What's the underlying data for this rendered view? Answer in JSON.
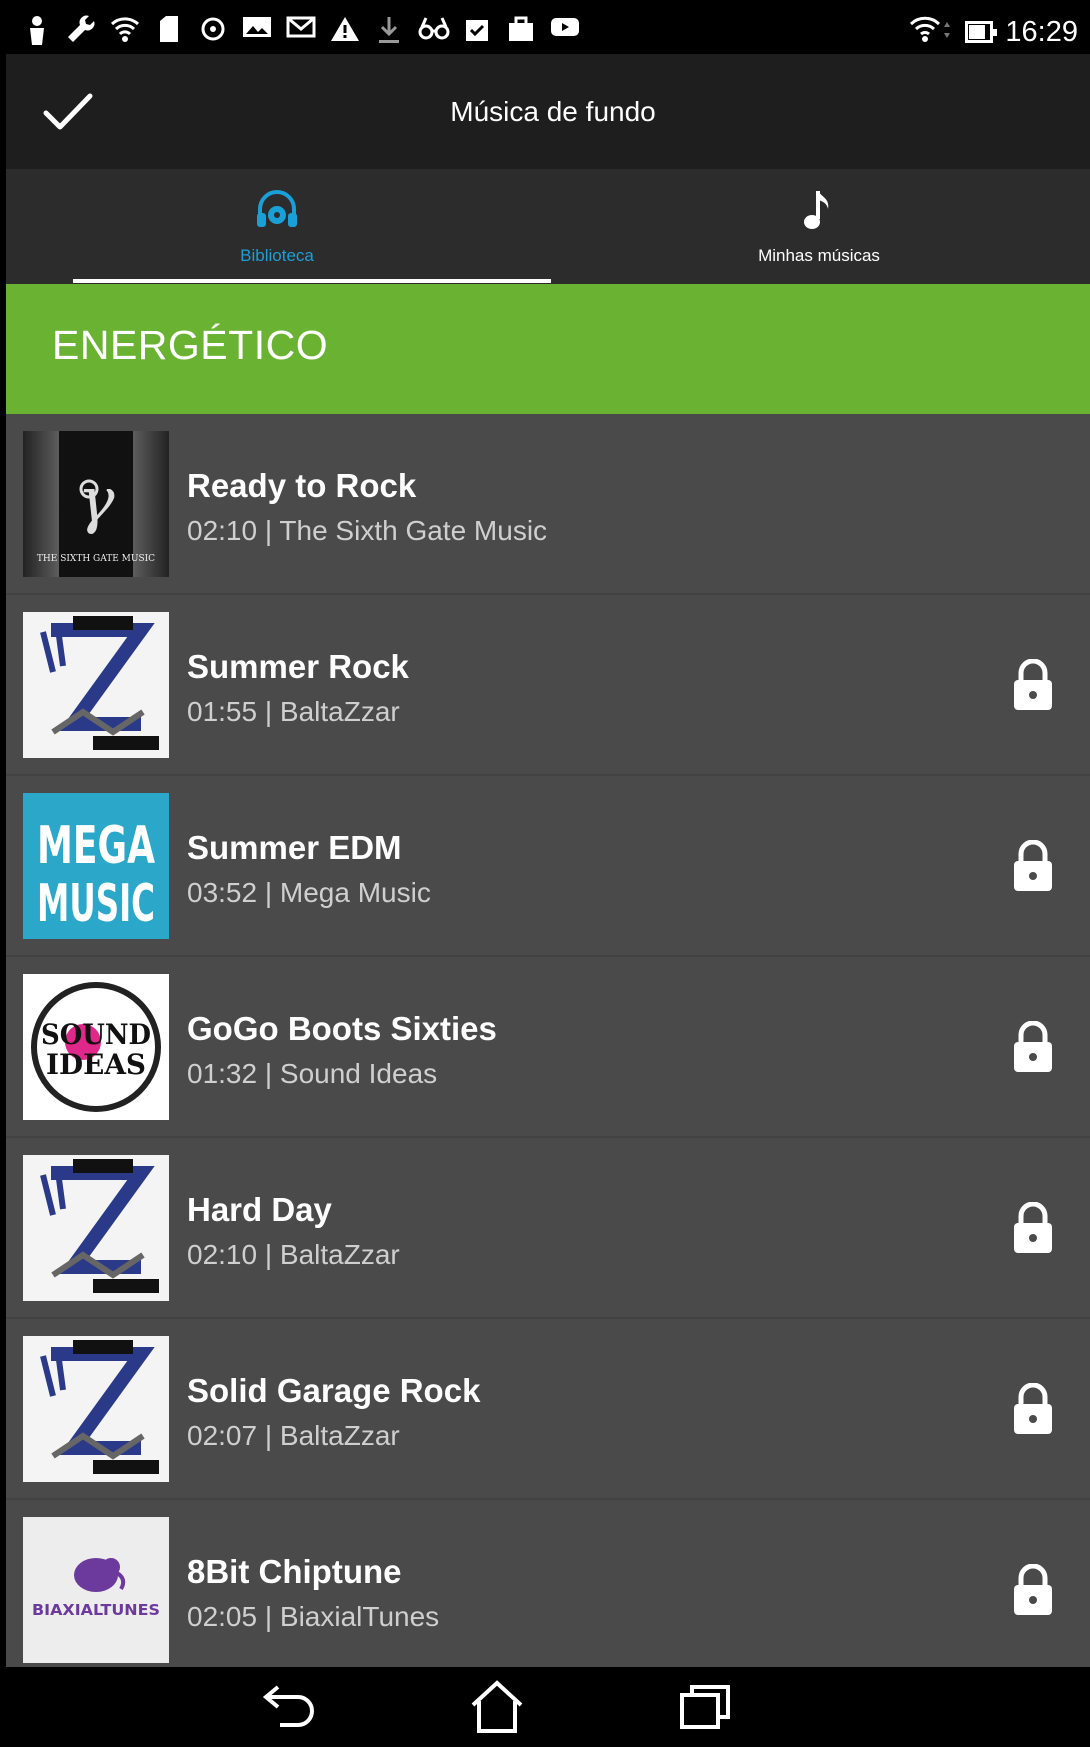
{
  "status_bar": {
    "time": "16:29",
    "left_icons": [
      "person-icon",
      "wrench-icon",
      "wifi-icon",
      "sd-card-icon",
      "sync-icon",
      "image-icon",
      "mail-icon",
      "warning-icon",
      "download-icon",
      "glasses-icon",
      "clipboard-check-icon",
      "bag-icon",
      "youtube-icon"
    ],
    "right_icons": [
      "wifi-icon",
      "battery-icon"
    ]
  },
  "app_bar": {
    "title": "Música de fundo",
    "confirm_icon": "check-icon"
  },
  "tabs": [
    {
      "label": "Biblioteca",
      "icon": "headphones-icon",
      "selected": true,
      "color": "#1a9fd6"
    },
    {
      "label": "Minhas músicas",
      "icon": "music-note-icon",
      "selected": false
    }
  ],
  "category": {
    "label": "ENERGÉTICO",
    "color": "#6ab332"
  },
  "tracks": [
    {
      "title": "Ready to Rock",
      "meta": "02:10 | The Sixth Gate Music",
      "locked": false,
      "thumb": "the-sixth-gate-music-logo",
      "thumb_text": "THE SIXTH GATE MUSIC"
    },
    {
      "title": "Summer Rock",
      "meta": "01:55 | BaltaZzar",
      "locked": true,
      "thumb": "baltazzar-logo"
    },
    {
      "title": "Summer EDM",
      "meta": "03:52 | Mega Music",
      "locked": true,
      "thumb": "mega-music-logo",
      "thumb_text": "MEGA MUSIC"
    },
    {
      "title": "GoGo Boots Sixties",
      "meta": "01:32 | Sound Ideas",
      "locked": true,
      "thumb": "sound-ideas-logo",
      "thumb_text": "SOUND IDEAS"
    },
    {
      "title": "Hard Day",
      "meta": "02:10 | BaltaZzar",
      "locked": true,
      "thumb": "baltazzar-logo"
    },
    {
      "title": "Solid Garage Rock",
      "meta": "02:07 | BaltaZzar",
      "locked": true,
      "thumb": "baltazzar-logo"
    },
    {
      "title": "8Bit Chiptune",
      "meta": "02:05 | BiaxialTunes",
      "locked": true,
      "thumb": "biaxialtunes-logo",
      "thumb_text": "BIAXIALTUNES"
    }
  ],
  "nav_bar": {
    "buttons": [
      "back-icon",
      "home-icon",
      "recents-icon"
    ]
  }
}
